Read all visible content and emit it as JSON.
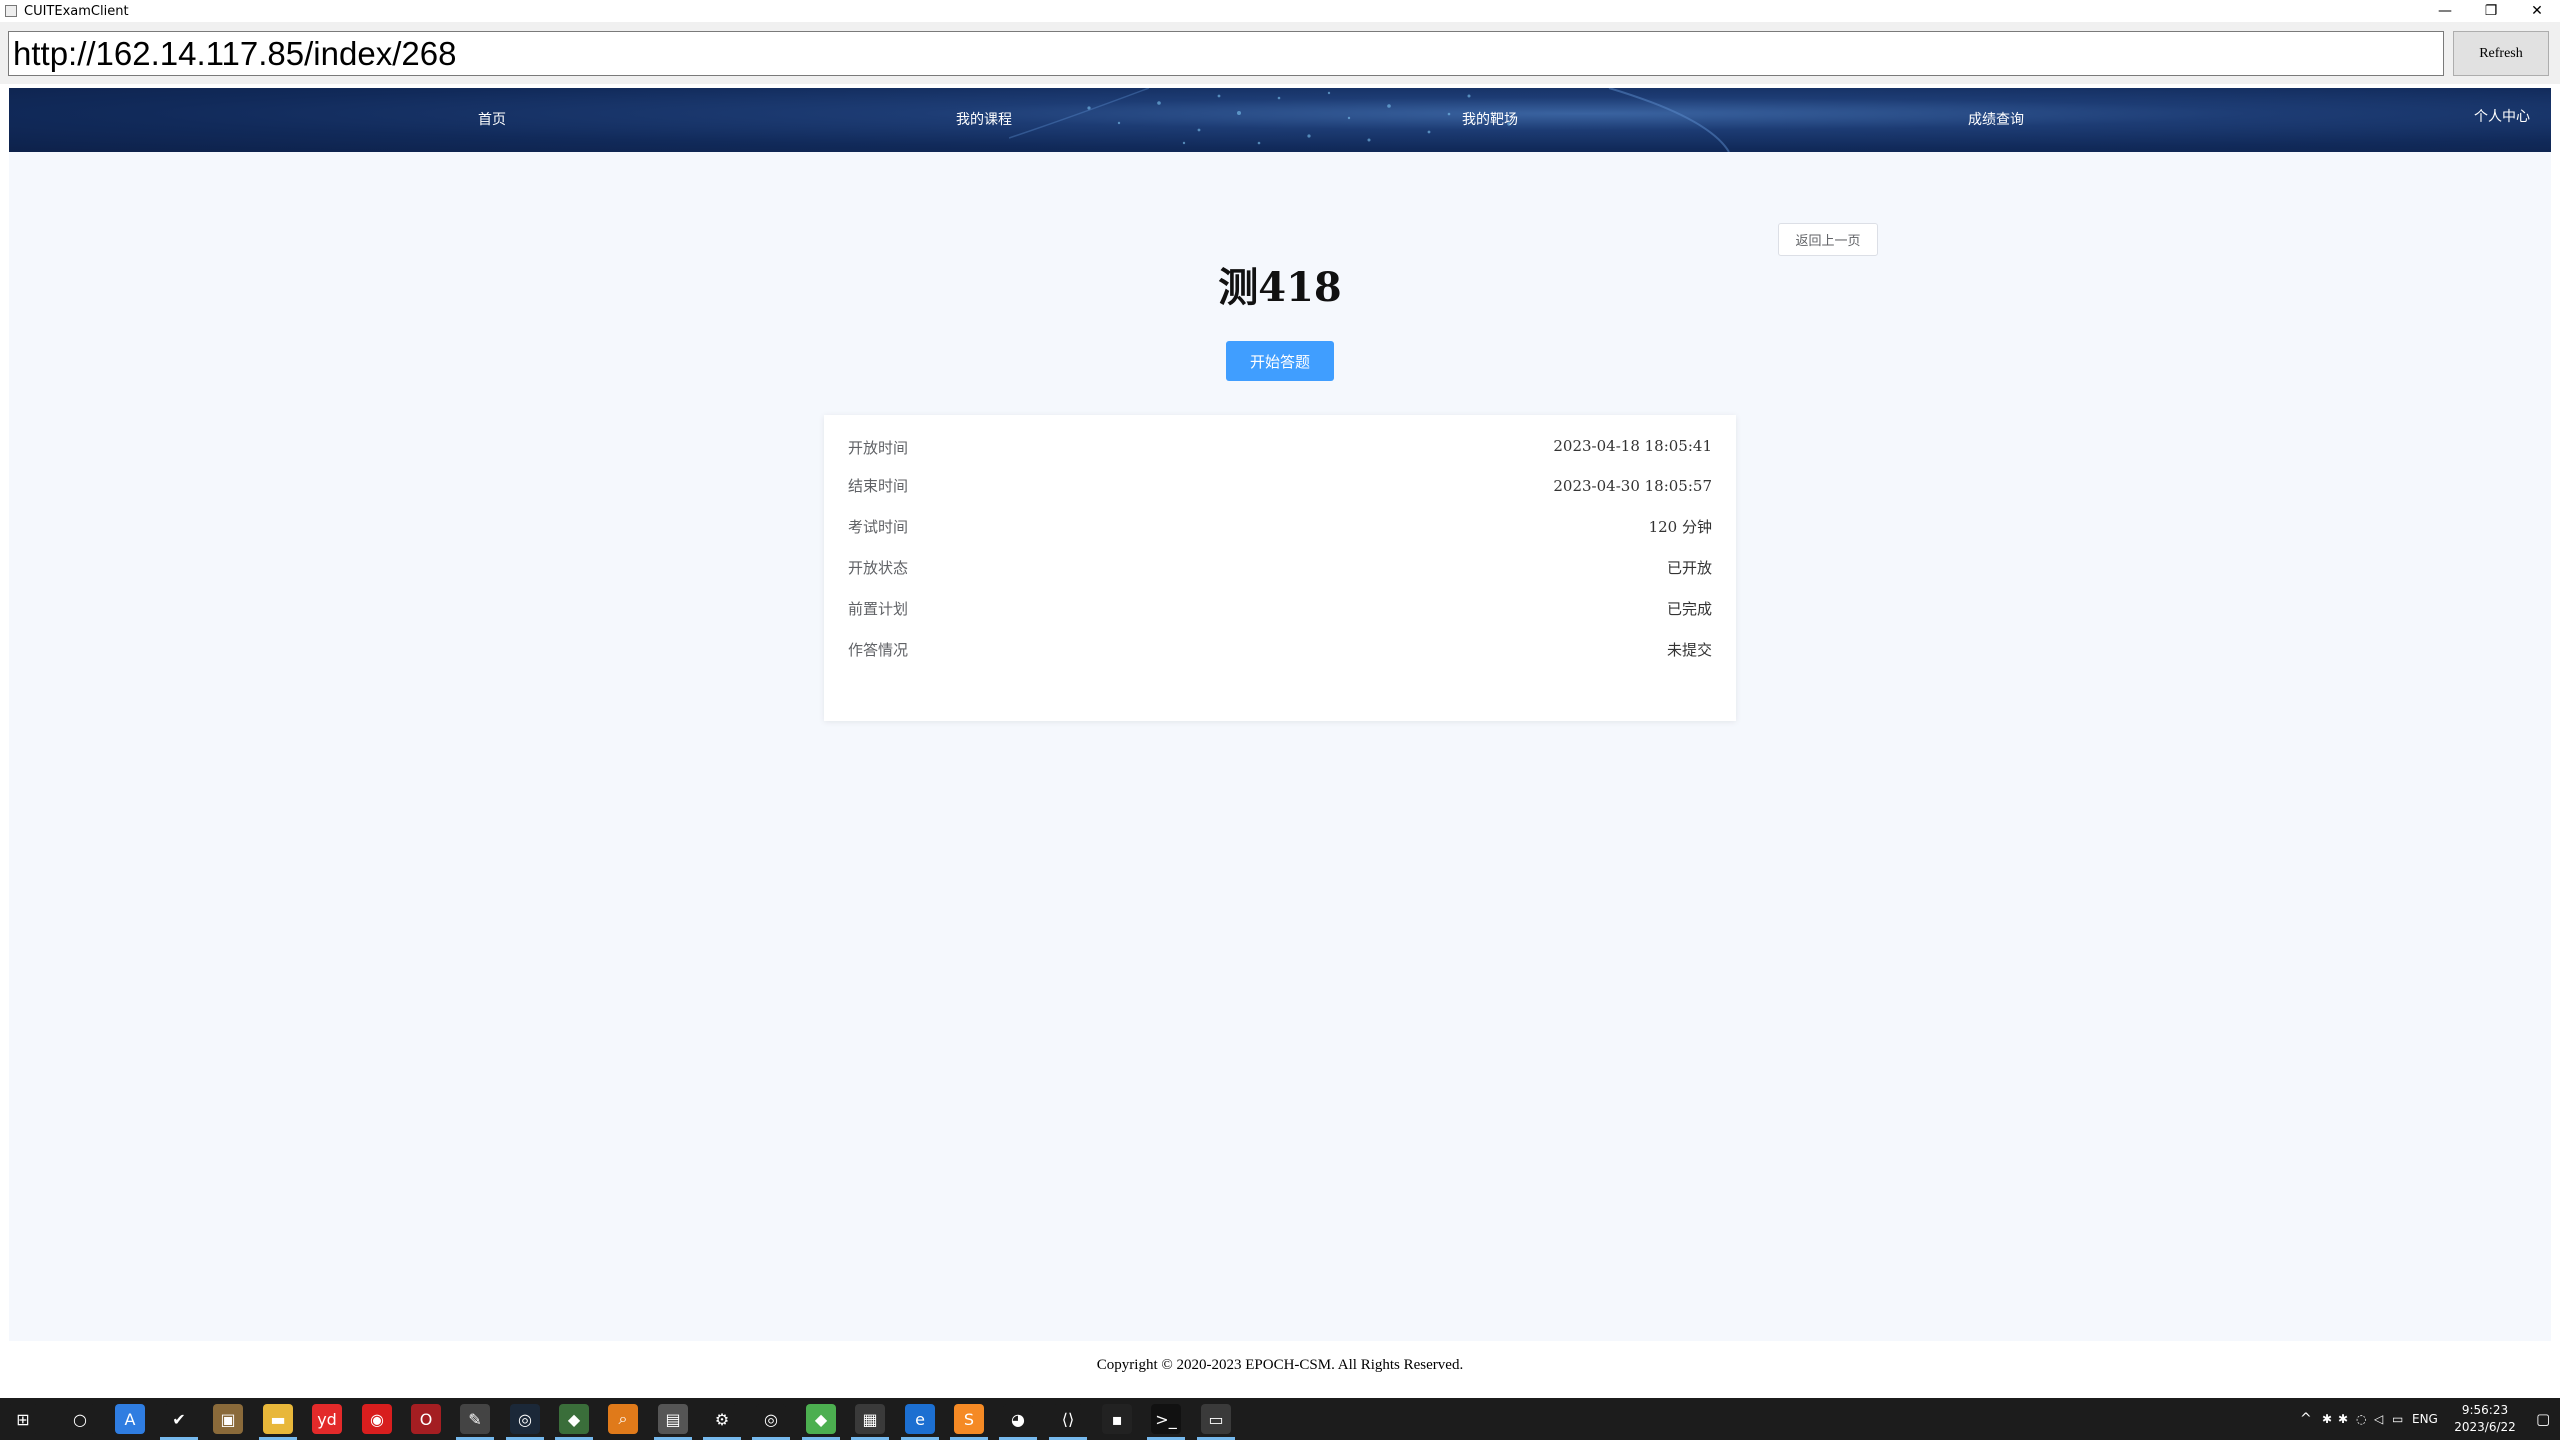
{
  "window": {
    "title": "CUITExamClient",
    "minimize": "—",
    "restore": "❐",
    "close": "✕"
  },
  "address_bar": {
    "url": "http://162.14.117.85/index/268",
    "refresh_label": "Refresh"
  },
  "nav": {
    "items": [
      {
        "label": "首页"
      },
      {
        "label": "我的课程"
      },
      {
        "label": "我的靶场"
      },
      {
        "label": "成绩查询"
      },
      {
        "label": "个人中心"
      }
    ]
  },
  "exam": {
    "back_label": "返回上一页",
    "title": "测418",
    "start_label": "开始答题",
    "info": [
      {
        "label": "开放时间",
        "value": "2023-04-18 18:05:41"
      },
      {
        "label": "结束时间",
        "value": "2023-04-30 18:05:57"
      },
      {
        "label": "考试时间",
        "value": "120 分钟"
      },
      {
        "label": "开放状态",
        "value": "已开放"
      },
      {
        "label": "前置计划",
        "value": "已完成"
      },
      {
        "label": "作答情况",
        "value": "未提交"
      }
    ]
  },
  "footer": {
    "copyright": "Copyright © 2020-2023 EPOCH-CSM. All Rights Reserved."
  },
  "taskbar": {
    "icons": [
      {
        "name": "windows-start-icon",
        "glyph": "⊞",
        "color": "#1c1c1c"
      },
      {
        "name": "search-icon",
        "glyph": "○",
        "color": "#1c1c1c"
      },
      {
        "name": "app-store-icon",
        "glyph": "A",
        "color": "#2f7de1"
      },
      {
        "name": "todo-icon",
        "glyph": "✔",
        "color": "#1c1c1c"
      },
      {
        "name": "package-icon",
        "glyph": "▣",
        "color": "#8a6a3a"
      },
      {
        "name": "file-explorer-icon",
        "glyph": "▬",
        "color": "#e8b73a"
      },
      {
        "name": "youdao-icon",
        "glyph": "yd",
        "color": "#e32a2a"
      },
      {
        "name": "netease-music-icon",
        "glyph": "◉",
        "color": "#d81e1e"
      },
      {
        "name": "opera-icon",
        "glyph": "O",
        "color": "#a41e22"
      },
      {
        "name": "notepad-icon",
        "glyph": "✎",
        "color": "#444"
      },
      {
        "name": "steam-icon",
        "glyph": "◎",
        "color": "#1b2838"
      },
      {
        "name": "chat-app-icon",
        "glyph": "◆",
        "color": "#3a6e3a"
      },
      {
        "name": "magnifier-icon",
        "glyph": "⌕",
        "color": "#e07a1a"
      },
      {
        "name": "window-icon",
        "glyph": "▤",
        "color": "#555"
      },
      {
        "name": "settings-gear-icon",
        "glyph": "⚙",
        "color": "#1c1c1c"
      },
      {
        "name": "circle-app-icon",
        "glyph": "◎",
        "color": "#1c1c1c"
      },
      {
        "name": "cube-icon",
        "glyph": "◆",
        "color": "#4caf50"
      },
      {
        "name": "calculator-icon",
        "glyph": "▦",
        "color": "#3a3a3a"
      },
      {
        "name": "edge-browser-icon",
        "glyph": "e",
        "color": "#1c6fd1"
      },
      {
        "name": "sublime-text-icon",
        "glyph": "S",
        "color": "#f58a25"
      },
      {
        "name": "wechat-icon",
        "glyph": "◕",
        "color": "#1c1c1c"
      },
      {
        "name": "vscode-icon",
        "glyph": "⟨⟩",
        "color": "#1c1c1c"
      },
      {
        "name": "charles-proxy-icon",
        "glyph": "▪",
        "color": "#222"
      },
      {
        "name": "terminal-icon",
        "glyph": ">_",
        "color": "#111"
      },
      {
        "name": "exam-client-icon",
        "glyph": "▭",
        "color": "#3a3a3a"
      }
    ],
    "tray": {
      "chevron": "^",
      "language": "ENG",
      "time": "9:56:23",
      "date": "2023/6/22"
    }
  }
}
